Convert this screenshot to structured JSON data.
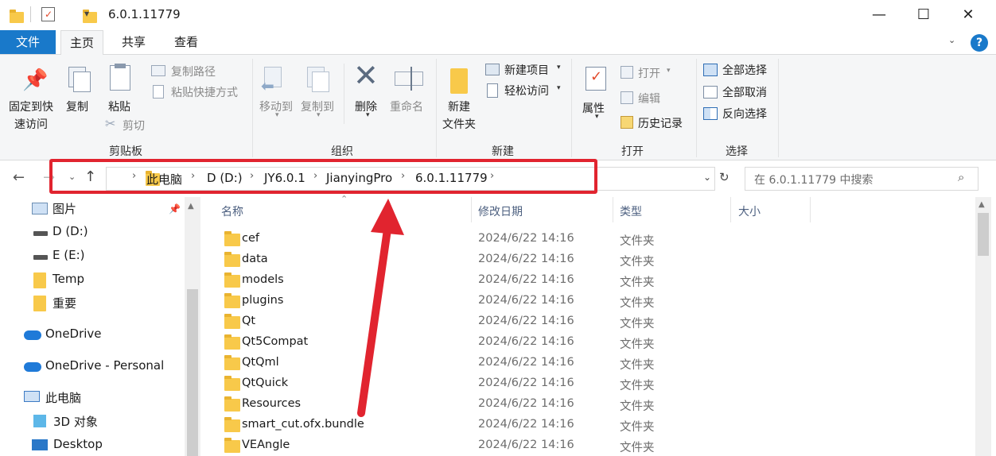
{
  "window": {
    "title": "6.0.1.11779",
    "minimize_glyph": "—",
    "maximize_glyph": "☐",
    "close_glyph": "✕"
  },
  "tabs": {
    "file": "文件",
    "home": "主页",
    "share": "共享",
    "view": "查看"
  },
  "ribbon": {
    "clipboard": {
      "pin_line1": "固定到快",
      "pin_line2": "速访问",
      "copy": "复制",
      "paste": "粘贴",
      "copy_path": "复制路径",
      "paste_shortcut": "粘贴快捷方式",
      "cut": "剪切",
      "group": "剪贴板"
    },
    "organize": {
      "move_to": "移动到",
      "copy_to": "复制到",
      "delete": "删除",
      "rename": "重命名",
      "group": "组织"
    },
    "new": {
      "new_folder_line1": "新建",
      "new_folder_line2": "文件夹",
      "new_item": "新建项目",
      "easy_access": "轻松访问",
      "group": "新建"
    },
    "open": {
      "properties": "属性",
      "open": "打开",
      "edit": "编辑",
      "history": "历史记录",
      "group": "打开"
    },
    "select": {
      "select_all": "全部选择",
      "select_none": "全部取消",
      "invert": "反向选择",
      "group": "选择"
    }
  },
  "address": {
    "crumbs": [
      "此电脑",
      "D (D:)",
      "JY6.0.1",
      "JianyingPro",
      "6.0.1.11779"
    ],
    "search_placeholder": "在 6.0.1.11779 中搜索"
  },
  "nav": {
    "items": [
      {
        "label": "图片",
        "icon": "pictures-icon"
      },
      {
        "label": "D (D:)",
        "icon": "drive-icon"
      },
      {
        "label": "E (E:)",
        "icon": "drive-icon"
      },
      {
        "label": "Temp",
        "icon": "folder-icon"
      },
      {
        "label": "重要",
        "icon": "folder-icon"
      },
      {
        "label": "OneDrive",
        "icon": "cloud-icon"
      },
      {
        "label": "OneDrive - Personal",
        "icon": "cloud-icon"
      },
      {
        "label": "此电脑",
        "icon": "computer-icon"
      },
      {
        "label": "3D 对象",
        "icon": "cube-icon"
      },
      {
        "label": "Desktop",
        "icon": "desktop-icon"
      }
    ]
  },
  "files": {
    "columns": {
      "name": "名称",
      "date": "修改日期",
      "type": "类型",
      "size": "大小"
    },
    "rows": [
      {
        "name": "cef",
        "date": "2024/6/22 14:16",
        "type": "文件夹"
      },
      {
        "name": "data",
        "date": "2024/6/22 14:16",
        "type": "文件夹"
      },
      {
        "name": "models",
        "date": "2024/6/22 14:16",
        "type": "文件夹"
      },
      {
        "name": "plugins",
        "date": "2024/6/22 14:16",
        "type": "文件夹"
      },
      {
        "name": "Qt",
        "date": "2024/6/22 14:16",
        "type": "文件夹"
      },
      {
        "name": "Qt5Compat",
        "date": "2024/6/22 14:16",
        "type": "文件夹"
      },
      {
        "name": "QtQml",
        "date": "2024/6/22 14:16",
        "type": "文件夹"
      },
      {
        "name": "QtQuick",
        "date": "2024/6/22 14:16",
        "type": "文件夹"
      },
      {
        "name": "Resources",
        "date": "2024/6/22 14:16",
        "type": "文件夹"
      },
      {
        "name": "smart_cut.ofx.bundle",
        "date": "2024/6/22 14:16",
        "type": "文件夹"
      },
      {
        "name": "VEAngle",
        "date": "2024/6/22 14:16",
        "type": "文件夹"
      }
    ]
  },
  "colors": {
    "accent": "#1979ca",
    "annotation": "#e1242f",
    "folder": "#f8c94a"
  }
}
